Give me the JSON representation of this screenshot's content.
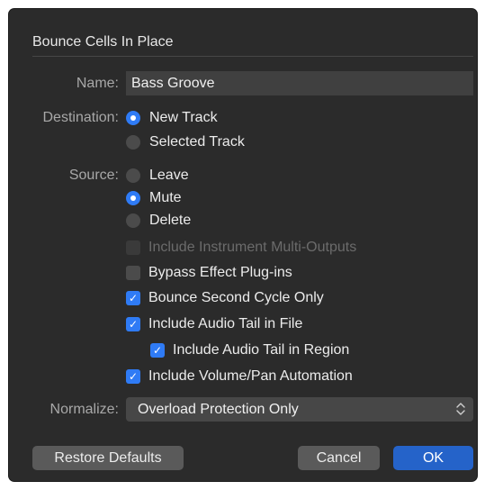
{
  "dialog": {
    "title": "Bounce Cells In Place",
    "name_label": "Name:",
    "name_value": "Bass Groove",
    "destination_label": "Destination:",
    "destination_options": [
      {
        "label": "New Track",
        "selected": true
      },
      {
        "label": "Selected Track",
        "selected": false
      }
    ],
    "source_label": "Source:",
    "source_options": [
      {
        "label": "Leave",
        "selected": false
      },
      {
        "label": "Mute",
        "selected": true
      },
      {
        "label": "Delete",
        "selected": false
      }
    ],
    "checkboxes": [
      {
        "label": "Include Instrument Multi-Outputs",
        "checked": false,
        "enabled": false
      },
      {
        "label": "Bypass Effect Plug-ins",
        "checked": false,
        "enabled": true
      },
      {
        "label": "Bounce Second Cycle Only",
        "checked": true,
        "enabled": true
      },
      {
        "label": "Include Audio Tail in File",
        "checked": true,
        "enabled": true
      },
      {
        "label": "Include Audio Tail in Region",
        "checked": true,
        "enabled": true
      },
      {
        "label": "Include Volume/Pan Automation",
        "checked": true,
        "enabled": true
      }
    ],
    "normalize_label": "Normalize:",
    "normalize_value": "Overload Protection Only",
    "restore_defaults_label": "Restore Defaults",
    "cancel_label": "Cancel",
    "ok_label": "OK"
  },
  "colors": {
    "background": "#2b2b2b",
    "accent": "#2f7bf5",
    "primary_button": "#2563c9"
  },
  "icons": {
    "checkmark": "✓",
    "popup_chevrons": "updown-chevron-icon"
  }
}
